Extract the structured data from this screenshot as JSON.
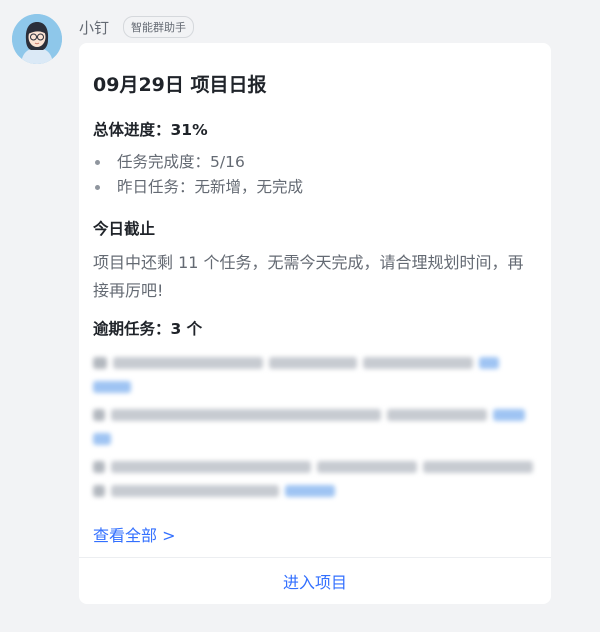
{
  "sender": {
    "name": "小钉",
    "tag": "智能群助手"
  },
  "card": {
    "title": "09月29日 项目日报",
    "progress_heading": "总体进度：31%",
    "bullets": [
      "任务完成度：5/16",
      "昨日任务：无新增，无完成"
    ],
    "today_heading": "今日截止",
    "today_text": "项目中还剩 11 个任务，无需今天完成，请合理规划时间，再接再厉吧!",
    "overdue_heading": "逾期任务：3 个",
    "view_all": "查看全部 >",
    "enter_project": "进入项目"
  },
  "colors": {
    "accent": "#3370ff",
    "card_bg": "#ffffff",
    "page_bg": "#f2f3f5"
  },
  "icons": {
    "avatar": "assistant-avatar"
  }
}
